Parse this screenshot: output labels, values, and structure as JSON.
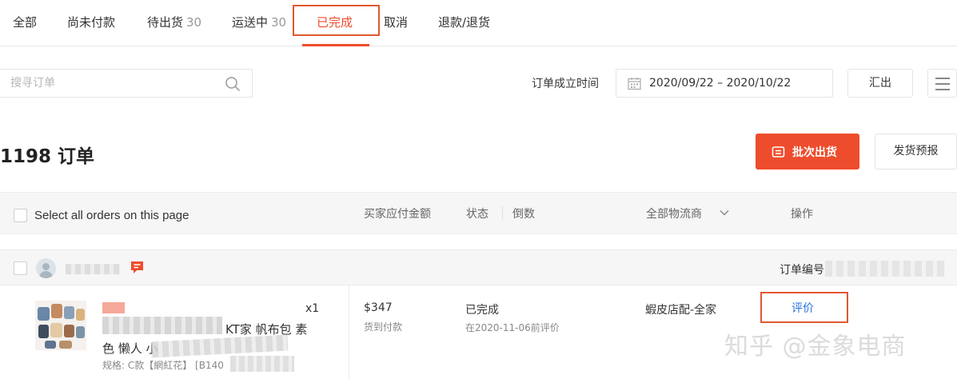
{
  "tabs": [
    {
      "label": "全部",
      "count": ""
    },
    {
      "label": "尚未付款",
      "count": ""
    },
    {
      "label": "待出货",
      "count": "30"
    },
    {
      "label": "运送中",
      "count": "30"
    },
    {
      "label": "已完成",
      "count": ""
    },
    {
      "label": "取消",
      "count": ""
    },
    {
      "label": "退款/退货",
      "count": ""
    }
  ],
  "active_tab": "已完成",
  "toolbar": {
    "search_placeholder": "搜寻订单",
    "date_label": "订单成立时间",
    "date_range": "2020/09/22 – 2020/10/22",
    "export_label": "汇出"
  },
  "summary": {
    "order_count": "1198 订单",
    "batch_ship_label": "批次出货",
    "ship_forecast_label": "发货预报"
  },
  "table_header": {
    "select_all": "Select all orders on this page",
    "amount": "买家应付金额",
    "status": "状态",
    "countdown": "倒数",
    "logistics": "全部物流商",
    "actions": "操作"
  },
  "order": {
    "order_number_label": "订单编号",
    "item": {
      "title_visible_1": "KT家 帆布包 素",
      "title_visible_2": "色 懒人 小",
      "spec": "规格: C款【網紅花】 [B140",
      "quantity": "x1"
    },
    "price": "$347",
    "payment_method": "货到付款",
    "status": "已完成",
    "status_note": "在2020-11-06前评价",
    "carrier": "蝦皮店配-全家",
    "action_label": "评价"
  },
  "watermark": "知乎 @金象电商",
  "colors": {
    "accent": "#ee4d2d",
    "highlight_box": "#e0582f",
    "link": "#2673dd"
  }
}
